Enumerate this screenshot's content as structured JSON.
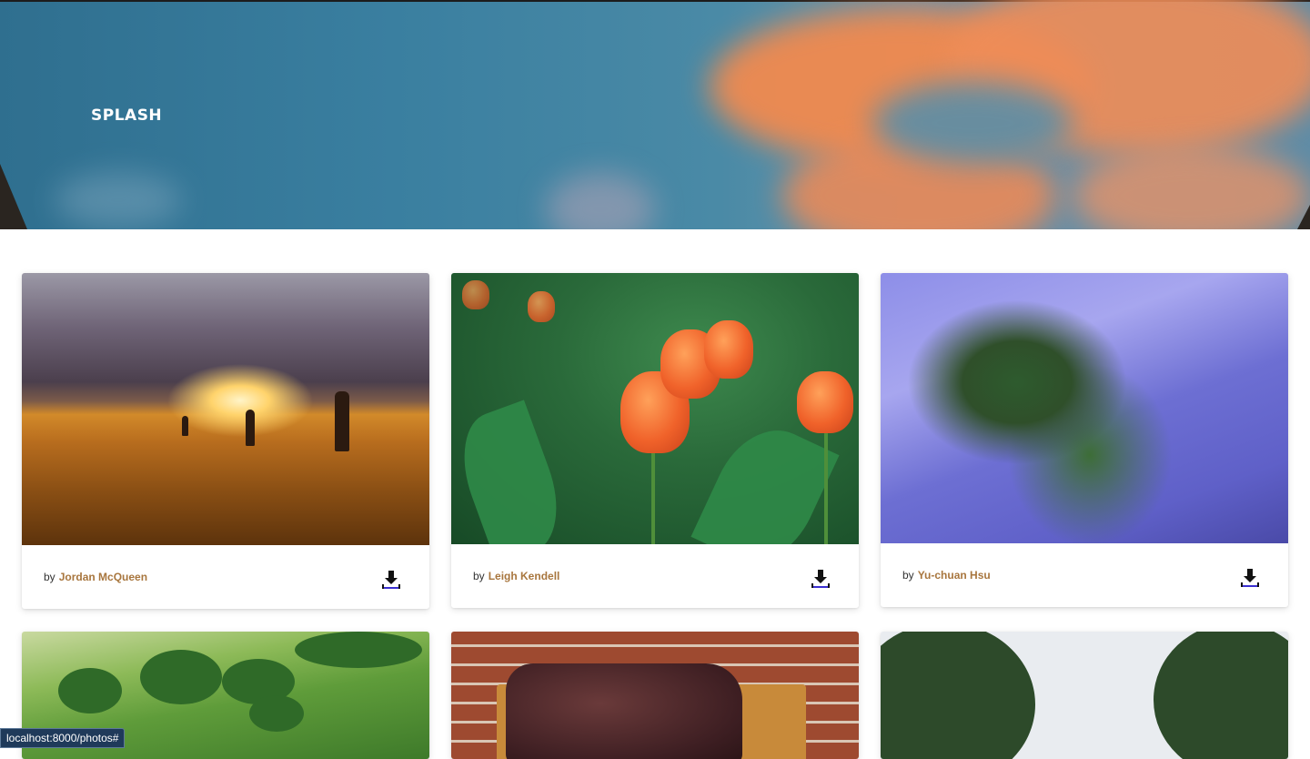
{
  "app": {
    "brand": "SPLASH"
  },
  "photos": [
    {
      "author_prefix": "by",
      "author": "Jordan McQueen",
      "download_icon": "download-icon"
    },
    {
      "author_prefix": "by",
      "author": "Leigh Kendell",
      "download_icon": "download-icon"
    },
    {
      "author_prefix": "by",
      "author": "Yu-chuan Hsu",
      "download_icon": "download-icon"
    }
  ],
  "status_bar": {
    "url": "localhost:8000/photos#"
  },
  "colors": {
    "author_link": "#a8763e",
    "brand_text": "#ffffff"
  }
}
